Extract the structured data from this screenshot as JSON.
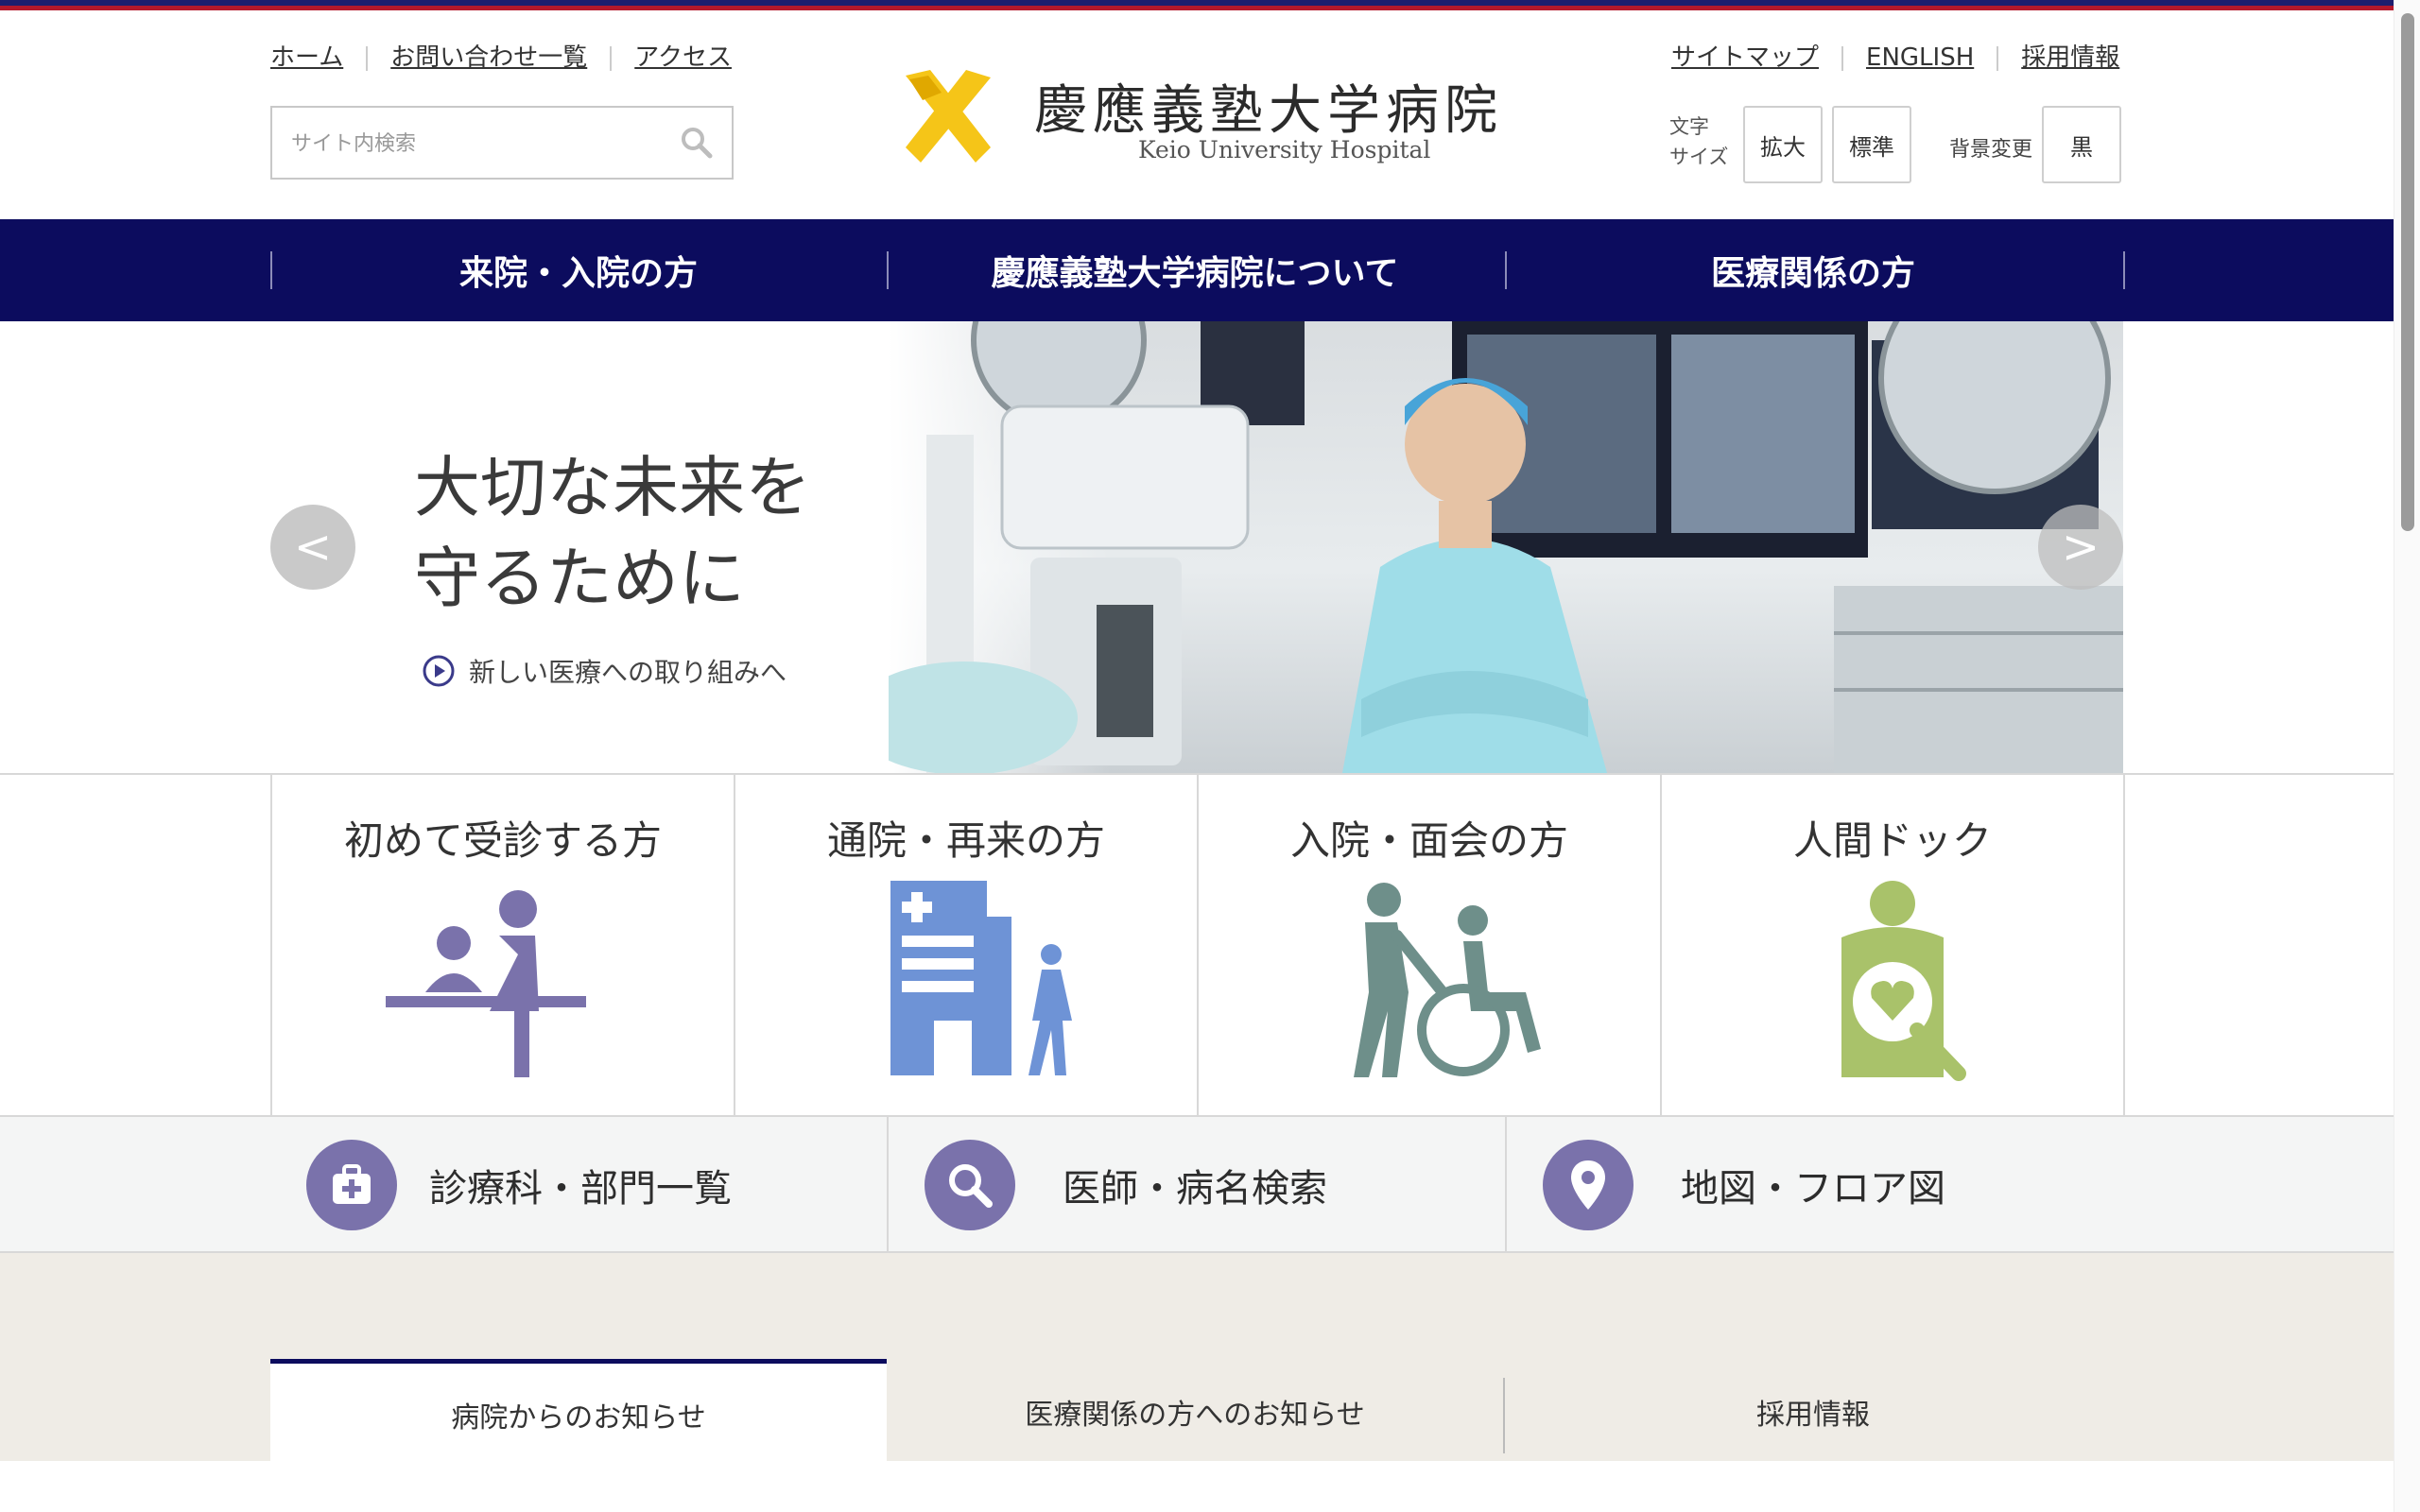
{
  "header": {
    "util_links": [
      "ホーム",
      "お問い合わせ一覧",
      "アクセス"
    ],
    "util_links_right": [
      "サイトマップ",
      "ENGLISH",
      "採用情報"
    ],
    "search_placeholder": "サイト内検索",
    "logo_jp": "慶應義塾大学病院",
    "logo_en": "Keio University Hospital",
    "font_size_label": "文字\nサイズ",
    "font_size_buttons": [
      "拡大",
      "標準"
    ],
    "bg_change_label": "背景変更",
    "bg_button": "黒"
  },
  "nav": {
    "items": [
      "来院・入院の方",
      "慶應義塾大学病院について",
      "医療関係の方"
    ]
  },
  "hero": {
    "title_line1": "大切な未来を",
    "title_line2": "守るために",
    "link": "新しい医療への取り組みへ",
    "prev": "<",
    "next": ">"
  },
  "cards": [
    {
      "label": "初めて受診する方",
      "icon": "reception-icon",
      "color": "#7a72ab"
    },
    {
      "label": "通院・再来の方",
      "icon": "hospital-walk-icon",
      "color": "#6e93d6"
    },
    {
      "label": "入院・面会の方",
      "icon": "wheelchair-icon",
      "color": "#6e8f8a"
    },
    {
      "label": "人間ドック",
      "icon": "checkup-icon",
      "color": "#a9c26a"
    }
  ],
  "quick_links": [
    {
      "label": "診療科・部門一覧",
      "icon": "medical-bag-icon"
    },
    {
      "label": "医師・病名検索",
      "icon": "search-icon"
    },
    {
      "label": "地図・フロア図",
      "icon": "map-pin-icon"
    }
  ],
  "news_tabs": [
    "病院からのお知らせ",
    "医療関係の方へのお知らせ",
    "採用情報"
  ],
  "colors": {
    "nav_bg": "#0c0c5e",
    "logo_yellow": "#f5c518",
    "accent_purple": "#7a72ab"
  }
}
